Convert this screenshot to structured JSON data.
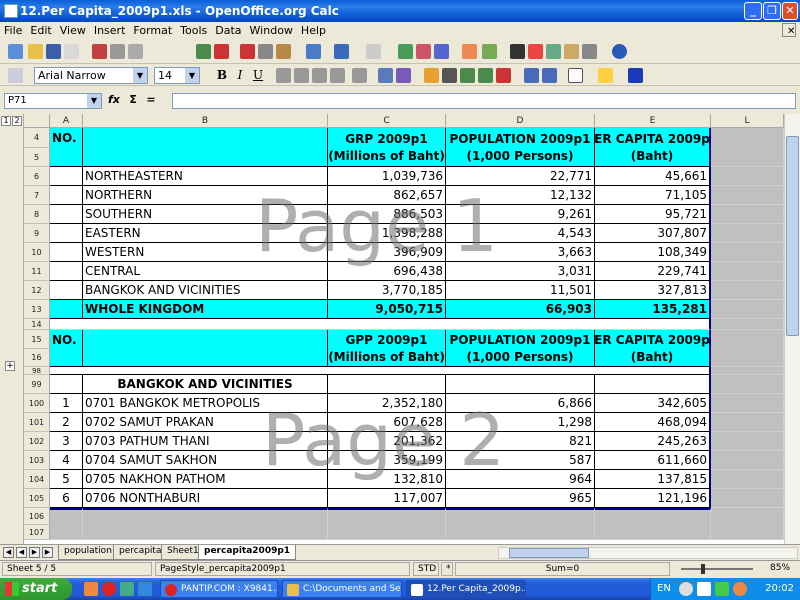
{
  "window": {
    "title": "12.Per Capita_2009p1.xls - OpenOffice.org Calc"
  },
  "menubar": [
    "File",
    "Edit",
    "View",
    "Insert",
    "Format",
    "Tools",
    "Data",
    "Window",
    "Help"
  ],
  "formatting": {
    "font_name": "Arial Narrow",
    "font_size": "14",
    "bold": "B",
    "italic": "I",
    "underline": "U"
  },
  "formula_bar": {
    "name_box": "P71",
    "fx": "fx",
    "sum": "Σ",
    "equals": "=",
    "content": ""
  },
  "columns": [
    "A",
    "B",
    "C",
    "D",
    "E",
    "L"
  ],
  "outline_levels": [
    "1",
    "2"
  ],
  "outline_expand": "+",
  "header1": {
    "no": "NO.",
    "grp_title": "GRP 2009p1",
    "grp_unit": "(Millions of Baht)",
    "pop_title": "POPULATION 2009p1",
    "pop_unit": "(1,000 Persons)",
    "pc_title": "ER CAPITA  2009p",
    "pc_unit": "(Baht)"
  },
  "region_rows": [
    {
      "row": "6",
      "name": "NORTHEASTERN",
      "grp": "1,039,736",
      "pop": "22,771",
      "pc": "45,661"
    },
    {
      "row": "7",
      "name": "NORTHERN",
      "grp": "862,657",
      "pop": "12,132",
      "pc": "71,105"
    },
    {
      "row": "8",
      "name": "SOUTHERN",
      "grp": "886,503",
      "pop": "9,261",
      "pc": "95,721"
    },
    {
      "row": "9",
      "name": "EASTERN",
      "grp": "1,398,288",
      "pop": "4,543",
      "pc": "307,807"
    },
    {
      "row": "10",
      "name": "WESTERN",
      "grp": "396,909",
      "pop": "3,663",
      "pc": "108,349"
    },
    {
      "row": "11",
      "name": "CENTRAL",
      "grp": "696,438",
      "pop": "3,031",
      "pc": "229,741"
    },
    {
      "row": "12",
      "name": "BANGKOK AND VICINITIES",
      "grp": "3,770,185",
      "pop": "11,501",
      "pc": "327,813"
    }
  ],
  "kingdom": {
    "row": "13",
    "name": "WHOLE KINGDOM",
    "grp": "9,050,715",
    "pop": "66,903",
    "pc": "135,281"
  },
  "header2": {
    "no": "NO.",
    "gpp_title": "GPP 2009p1",
    "gpp_unit": "(Millions of Baht)",
    "pop_title": "POPULATION 2009p1",
    "pop_unit": "(1,000 Persons)",
    "pc_title": "ER CAPITA  2009p",
    "pc_unit": "(Baht)"
  },
  "section_title": "BANGKOK AND VICINITIES",
  "province_rows": [
    {
      "row": "100",
      "no": "1",
      "name": "0701 BANGKOK METROPOLIS",
      "gpp": "2,352,180",
      "pop": "6,866",
      "pc": "342,605"
    },
    {
      "row": "101",
      "no": "2",
      "name": "0702 SAMUT PRAKAN",
      "gpp": "607,628",
      "pop": "1,298",
      "pc": "468,094"
    },
    {
      "row": "102",
      "no": "3",
      "name": "0703 PATHUM THANI",
      "gpp": "201,362",
      "pop": "821",
      "pc": "245,263"
    },
    {
      "row": "103",
      "no": "4",
      "name": "0704 SAMUT SAKHON",
      "gpp": "359,199",
      "pop": "587",
      "pc": "611,660"
    },
    {
      "row": "104",
      "no": "5",
      "name": "0705 NAKHON PATHOM",
      "gpp": "132,810",
      "pop": "964",
      "pc": "137,815"
    },
    {
      "row": "105",
      "no": "6",
      "name": "0706 NONTHABURI",
      "gpp": "117,007",
      "pop": "965",
      "pc": "121,196"
    }
  ],
  "row_numbers": {
    "r4": "4",
    "r5": "5",
    "r14": "14",
    "r15": "15",
    "r16": "16",
    "r98": "98",
    "r99": "99",
    "r106": "106",
    "r107": "107"
  },
  "watermarks": {
    "page1": "Page 1",
    "page2": "Page 2"
  },
  "sheet_tabs": [
    "population",
    "percapita",
    "Sheet1",
    "percapita2009p1"
  ],
  "active_tab": "percapita2009p1",
  "status": {
    "sheet": "Sheet 5 / 5",
    "pagestyle": "PageStyle_percapita2009p1",
    "mode": "STD",
    "modified": "*",
    "sum": "Sum=0",
    "zoom": "85%"
  },
  "taskbar": {
    "start": "start",
    "tasks": [
      "PANTIP.COM : X9841...",
      "C:\\Documents and Se...",
      "12.Per Capita_2009p..."
    ],
    "lang": "EN",
    "time": "20:02"
  }
}
